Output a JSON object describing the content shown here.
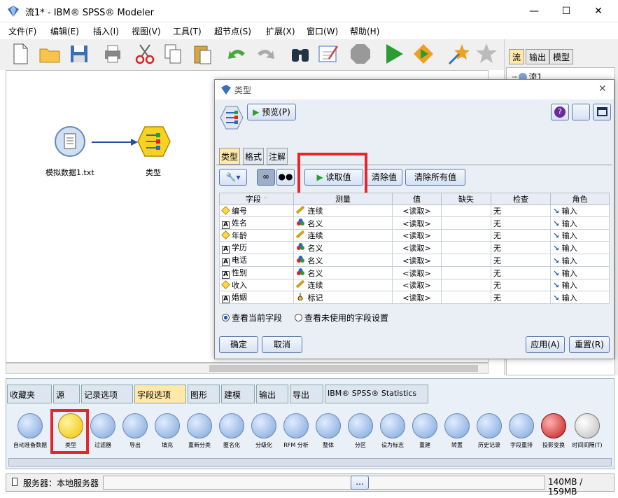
{
  "window": {
    "title": "流1* - IBM® SPSS® Modeler",
    "min": "—",
    "max": "☐",
    "close": "✕"
  },
  "menu": [
    "文件(F)",
    "编辑(E)",
    "插入(I)",
    "视图(V)",
    "工具(T)",
    "超节点(S)",
    "扩展(X)",
    "窗口(W)",
    "帮助(H)"
  ],
  "right_panel": {
    "tabs": [
      "流",
      "输出",
      "模型"
    ],
    "tree_item": "流1"
  },
  "canvas": {
    "source_node": "模拟数据1.txt",
    "type_node": "类型"
  },
  "dialog": {
    "title": "类型",
    "preview_button": "预览(P)",
    "tabs": [
      "类型",
      "格式",
      "注解"
    ],
    "read_values": "读取值",
    "clear_values": "清除值",
    "clear_all_values": "清除所有值",
    "columns": [
      "字段",
      "测量",
      "值",
      "缺失",
      "检查",
      "角色"
    ],
    "rows": [
      {
        "icon": "diamond",
        "field": "编号",
        "measure_icon": "ruler",
        "measure": "连续",
        "value": "<读取>",
        "missing": "",
        "check": "无",
        "role": "输入"
      },
      {
        "icon": "A",
        "field": "姓名",
        "measure_icon": "balls",
        "measure": "名义",
        "value": "<读取>",
        "missing": "",
        "check": "无",
        "role": "输入"
      },
      {
        "icon": "diamond",
        "field": "年龄",
        "measure_icon": "ruler",
        "measure": "连续",
        "value": "<读取>",
        "missing": "",
        "check": "无",
        "role": "输入"
      },
      {
        "icon": "A",
        "field": "学历",
        "measure_icon": "balls",
        "measure": "名义",
        "value": "<读取>",
        "missing": "",
        "check": "无",
        "role": "输入"
      },
      {
        "icon": "A",
        "field": "电话",
        "measure_icon": "balls",
        "measure": "名义",
        "value": "<读取>",
        "missing": "",
        "check": "无",
        "role": "输入"
      },
      {
        "icon": "A",
        "field": "性别",
        "measure_icon": "balls",
        "measure": "名义",
        "value": "<读取>",
        "missing": "",
        "check": "无",
        "role": "输入"
      },
      {
        "icon": "diamond",
        "field": "收入",
        "measure_icon": "ruler",
        "measure": "连续",
        "value": "<读取>",
        "missing": "",
        "check": "无",
        "role": "输入"
      },
      {
        "icon": "A",
        "field": "婚姻",
        "measure_icon": "flag",
        "measure": "标记",
        "value": "<读取>",
        "missing": "",
        "check": "无",
        "role": "输入"
      }
    ],
    "radio_current": "查看当前字段",
    "radio_unused": "查看未使用的字段设置",
    "ok": "确定",
    "cancel": "取消",
    "apply": "应用(A)",
    "reset": "重置(R)"
  },
  "palette": {
    "tabs": [
      "收藏夹",
      "源",
      "记录选项",
      "字段选项",
      "图形",
      "建模",
      "输出",
      "导出",
      "IBM® SPSS® Statistics"
    ],
    "nodes": [
      "自动准备数据",
      "类型",
      "过滤器",
      "导出",
      "填充",
      "重新分类",
      "匿名化",
      "分级化",
      "RFM 分析",
      "整体",
      "分区",
      "设为标志",
      "重建",
      "转置",
      "历史记录",
      "字段重排",
      "投影变换",
      "时间间隔(T)"
    ]
  },
  "status": {
    "server": "服务器：本地服务器",
    "ellipsis": "...",
    "memory": "140MB / 159MB"
  }
}
